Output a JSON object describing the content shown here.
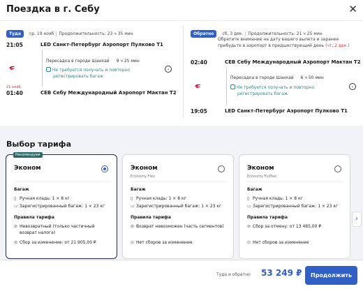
{
  "header": {
    "title": "Поездка в г. Себу",
    "close_glyph": "✕"
  },
  "outbound": {
    "tag": "Туда",
    "date": "ср, 19 нояб",
    "duration": "Продолжительность: 23 ч 35 мин",
    "dep_time": "21:05",
    "dep_airport": "LED Санкт-Петербург Аэропорт Пулково Т1",
    "transfer_city": "Пересадка в городе Шанхай",
    "transfer_dur": "9 ч 25 мин",
    "note1": "Не требуется получать и повторно",
    "note2": "регистрировать багаж",
    "arr_date_note": "21 нояб.",
    "arr_time": "01:40",
    "arr_airport": "CEB Себу Международный Аэропорт Мактан Т2"
  },
  "inbound": {
    "tag": "Обратно",
    "date": "сб, 3 дек.",
    "duration": "Продолжительность: 21 ч 25 мин",
    "warn1": "Обратите внимание на дату вашего вылета и заранее",
    "warn2": "прибудьте в аэропорт в предшествующий день",
    "warn_red": "(чт, 2 дек.)",
    "dep_time": "02:40",
    "dep_airport": "CEB Себу Международный Аэропорт Мактан Т2",
    "transfer_city": "Пересадка в городе Шанхай",
    "transfer_dur": "6 ч 50 мин",
    "note1": "Не требуется получать и повторно",
    "note2": "регистрировать багаж",
    "arr_time": "19:05",
    "arr_airport": "LED Санкт-Петербург Аэропорт Пулково Т1"
  },
  "tariff": {
    "section_title": "Выбор тарифа",
    "cards": [
      {
        "badge": "Рекомендуем",
        "name": "Эконом",
        "sub": "",
        "baggage": "Багаж",
        "hand": "Ручная кладь: 1 × 8 кг",
        "checked": "Зарегистрированный багаж: 1 × 23 кг",
        "rules": "Правила тарифа",
        "r1a": "Невозвратный (только частичный",
        "r1b": "возврат налога)",
        "r2": "Сбор за изменение: от 21 905,00 ₽"
      },
      {
        "name": "Эконом",
        "sub": "Economy Flex",
        "baggage": "Багаж",
        "hand": "Ручная кладь: 1 × 8 кг",
        "checked": "Зарегистрированный багаж: 1 × 23 кг",
        "rules": "Правила тарифа",
        "r1a": "Возврат невозможен (часть сегментов)",
        "r2": "Нет сборов за изменение"
      },
      {
        "name": "Эконом",
        "sub": "Economy Fullflex",
        "baggage": "Багаж",
        "hand": "Ручная кладь: 1 × 8 кг",
        "checked": "Зарегистрированный багаж: 1 × 23 кг",
        "rules": "Правила тарифа",
        "r1a": "Сбор за отмену: от 13 485,00 ₽",
        "r2": "Нет сборов за изменение"
      }
    ]
  },
  "footer": {
    "total_label": "Туда и обратно",
    "total": "53 249 ₽",
    "continue": "Продолжить"
  },
  "colors": {
    "accent": "#2e60c7",
    "airline": "#c8102e"
  }
}
